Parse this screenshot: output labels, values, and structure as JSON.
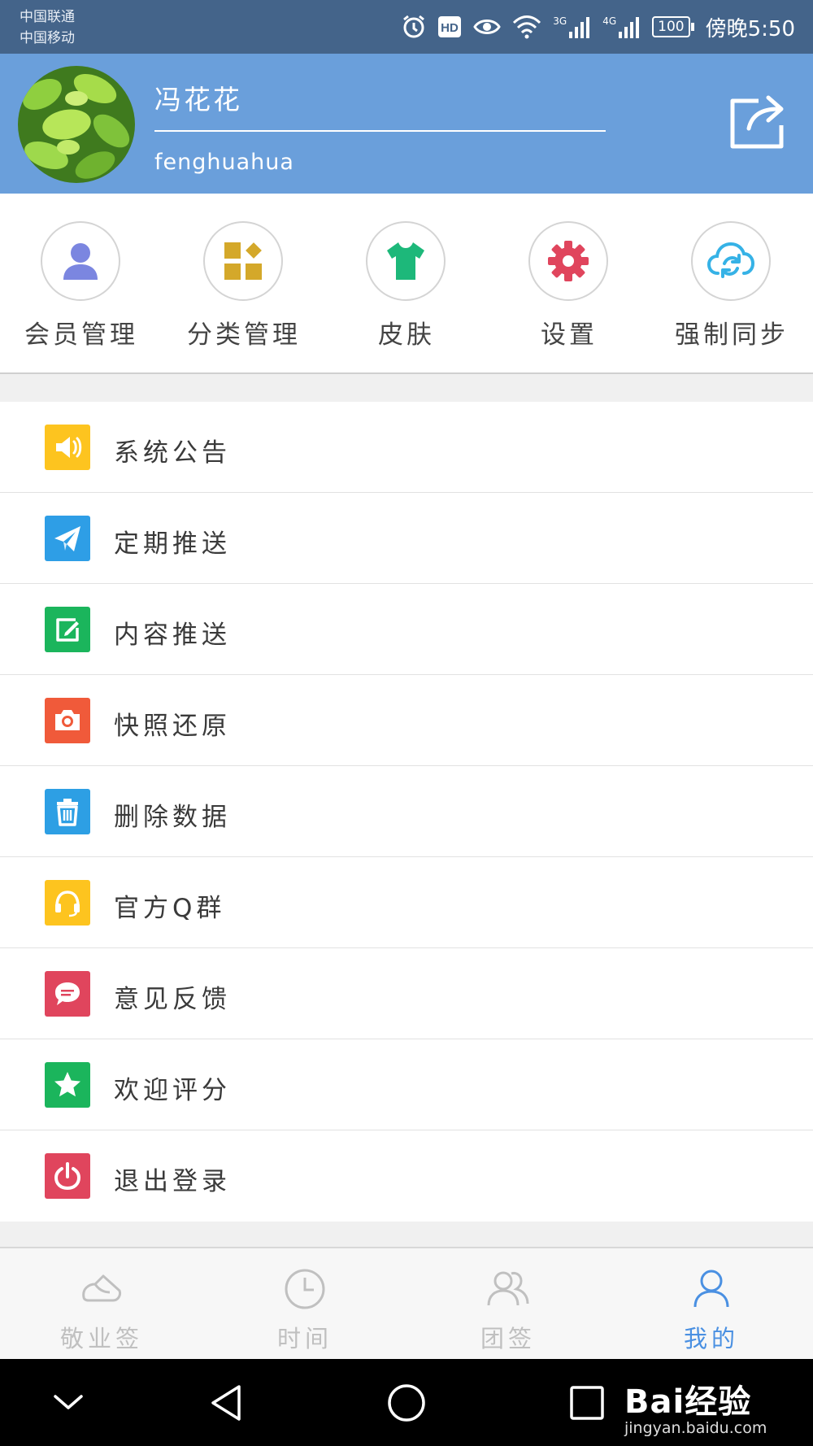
{
  "status_bar": {
    "carrier_1": "中国联通",
    "carrier_2": "中国移动",
    "net_1": "3G",
    "net_2": "4G",
    "battery": "100",
    "time": "傍晚5:50"
  },
  "profile": {
    "name": "冯花花",
    "username": "fenghuahua"
  },
  "quick_actions": [
    {
      "label": "会员管理",
      "icon": "user-icon",
      "color": "#7b86e0"
    },
    {
      "label": "分类管理",
      "icon": "category-icon",
      "color": "#d4a82a"
    },
    {
      "label": "皮肤",
      "icon": "tshirt-icon",
      "color": "#1db87a"
    },
    {
      "label": "设置",
      "icon": "gear-icon",
      "color": "#e0455d"
    },
    {
      "label": "强制同步",
      "icon": "cloud-sync-icon",
      "color": "#36b2e6"
    }
  ],
  "menu": [
    {
      "label": "系统公告",
      "icon": "speaker-icon",
      "color": "#fdc41f"
    },
    {
      "label": "定期推送",
      "icon": "paper-plane-icon",
      "color": "#2e9ee6"
    },
    {
      "label": "内容推送",
      "icon": "edit-icon",
      "color": "#1bb55c"
    },
    {
      "label": "快照还原",
      "icon": "camera-icon",
      "color": "#f05a3a"
    },
    {
      "label": "删除数据",
      "icon": "trash-icon",
      "color": "#2d9fe4"
    },
    {
      "label": "官方Q群",
      "icon": "headset-icon",
      "color": "#fdc41f"
    },
    {
      "label": "意见反馈",
      "icon": "chat-bubble-icon",
      "color": "#e0455d"
    },
    {
      "label": "欢迎评分",
      "icon": "star-icon",
      "color": "#1bb55c"
    },
    {
      "label": "退出登录",
      "icon": "power-icon",
      "color": "#e0455d"
    }
  ],
  "tabs": [
    {
      "label": "敬业签",
      "icon": "note-icon",
      "active": false
    },
    {
      "label": "时间",
      "icon": "clock-icon",
      "active": false
    },
    {
      "label": "团签",
      "icon": "group-icon",
      "active": false
    },
    {
      "label": "我的",
      "icon": "person-icon",
      "active": true
    }
  ],
  "watermark": {
    "brand": "Bai经验",
    "url": "jingyan.baidu.com"
  },
  "colors": {
    "header_bg": "#6a9fdb",
    "status_bg": "#44648a",
    "tab_active": "#4a90e2",
    "tab_inactive": "#c0c0c0"
  }
}
